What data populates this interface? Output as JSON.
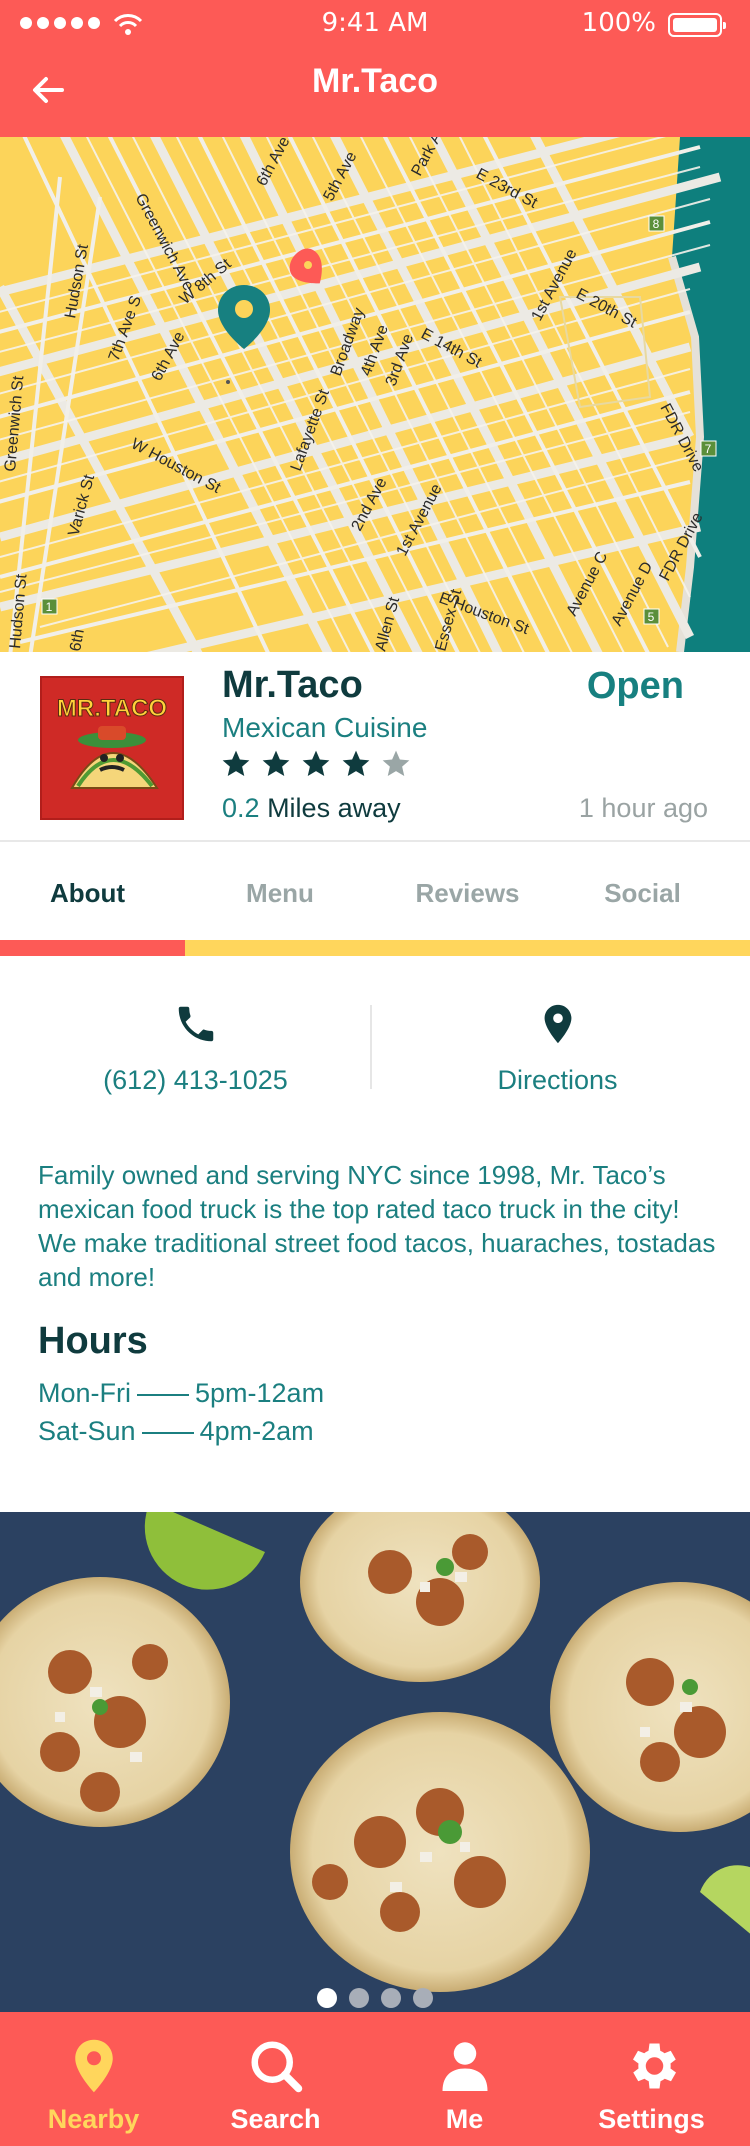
{
  "status_bar": {
    "time": "9:41 AM",
    "battery": "100%"
  },
  "nav": {
    "title": "Mr.Taco"
  },
  "map": {
    "street_labels": [
      "6th Ave",
      "5th Ave",
      "Park Ave",
      "E 23rd St",
      "Greenwich Ave",
      "Hudson St",
      "7th Ave S",
      "W 8th St",
      "6th Ave",
      "Broadway",
      "4th Ave",
      "3rd Ave",
      "E 14th St",
      "1st Avenue",
      "E 20th St",
      "FDR Drive",
      "W Houston St",
      "Lafayette St",
      "2nd Ave",
      "1st Avenue",
      "Greenwich St",
      "Varick St",
      "Avenue C",
      "Avenue D",
      "FDR Drive",
      "E Houston St",
      "Allen St",
      "Essex St",
      "6th",
      "Hudson St"
    ],
    "route_badges": [
      "8",
      "7",
      "1",
      "5"
    ]
  },
  "business": {
    "name": "Mr.Taco",
    "cuisine": "Mexican Cuisine",
    "rating": 4,
    "rating_max": 5,
    "distance_value": "0.2",
    "distance_unit": "Miles away",
    "status": "Open",
    "updated": "1 hour ago",
    "logo_text": "MR.TACO"
  },
  "tabs": [
    {
      "label": "About",
      "active": true
    },
    {
      "label": "Menu",
      "active": false
    },
    {
      "label": "Reviews",
      "active": false
    },
    {
      "label": "Social",
      "active": false
    }
  ],
  "actions": {
    "phone": "(612) 413-1025",
    "directions": "Directions"
  },
  "description": "Family owned and serving NYC since 1998, Mr. Taco’s mexican food truck is the top rated taco truck in the city! We make traditional street food tacos, huaraches, tostadas and more!",
  "hours": {
    "title": "Hours",
    "rows": [
      {
        "days": "Mon-Fri",
        "time": "5pm-12am"
      },
      {
        "days": "Sat-Sun",
        "time": "4pm-2am"
      }
    ]
  },
  "gallery": {
    "count": 4,
    "active_index": 0
  },
  "bottom_nav": [
    {
      "label": "Nearby",
      "icon": "pin-icon",
      "active": true
    },
    {
      "label": "Search",
      "icon": "search-icon",
      "active": false
    },
    {
      "label": "Me",
      "icon": "person-icon",
      "active": false
    },
    {
      "label": "Settings",
      "icon": "gear-icon",
      "active": false
    }
  ],
  "colors": {
    "primary": "#fd5a56",
    "teal": "#1b7f80",
    "dark_teal": "#0f3b3e",
    "yellow": "#ffd65c",
    "map_water": "#0e7f7d"
  }
}
